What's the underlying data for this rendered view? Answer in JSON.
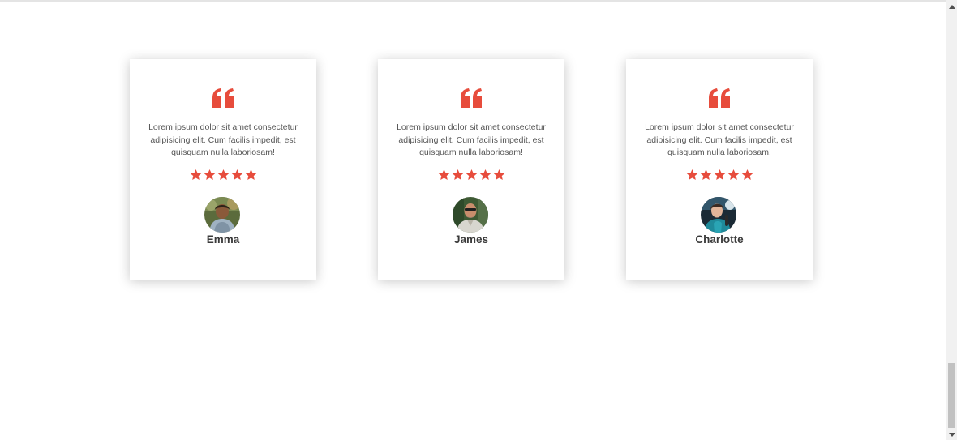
{
  "accent_color": "#e74c3c",
  "icons": {
    "quote": "quote-left-icon",
    "star": "star-icon",
    "scroll_up": "arrow-up-icon",
    "scroll_down": "arrow-down-icon"
  },
  "testimonials": [
    {
      "text": "Lorem ipsum dolor sit amet consectetur adipisicing elit. Cum facilis impedit, est quisquam nulla laboriosam!",
      "rating": 5,
      "name": "Emma"
    },
    {
      "text": "Lorem ipsum dolor sit amet consectetur adipisicing elit. Cum facilis impedit, est quisquam nulla laboriosam!",
      "rating": 5,
      "name": "James"
    },
    {
      "text": "Lorem ipsum dolor sit amet consectetur adipisicing elit. Cum facilis impedit, est quisquam nulla laboriosam!",
      "rating": 5,
      "name": "Charlotte"
    }
  ]
}
